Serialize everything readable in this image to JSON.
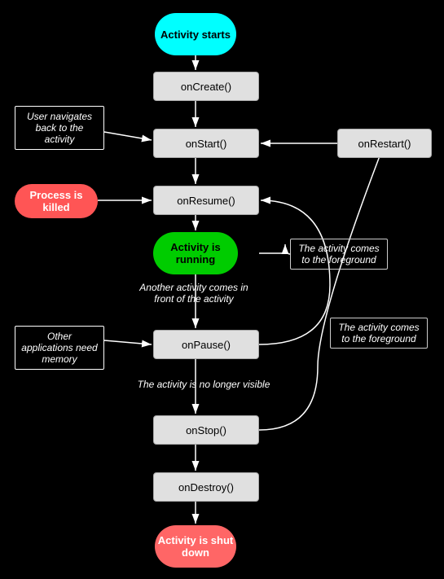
{
  "nodes": {
    "activity_starts": "Activity starts",
    "oncreate": "onCreate()",
    "onstart": "onStart()",
    "onrestart": "onRestart()",
    "onresume": "onResume()",
    "activity_running": "Activity is running",
    "onpause": "onPause()",
    "onstop": "onStop()",
    "ondestroy": "onDestroy()",
    "activity_shutdown": "Activity is shut down"
  },
  "labels": {
    "user_navigates": "User navigates back to the activity",
    "process_killed": "Process is killed",
    "another_activity": "Another activity comes in front of the activity",
    "other_apps": "Other applications need memory",
    "no_longer_visible": "The activity is no longer visible",
    "foreground_1": "The activity comes to the foreground",
    "foreground_2": "The activity comes to the foreground"
  }
}
